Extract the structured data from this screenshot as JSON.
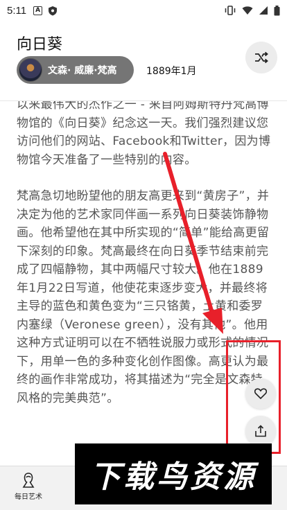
{
  "status_bar": {
    "time": "5:11",
    "left_icons": [
      "A-notification-icon",
      "shield-icon"
    ],
    "right_icons": [
      "vibrate-icon",
      "wifi-icon",
      "signal-icon",
      "battery-icon"
    ],
    "a_glyph": "A"
  },
  "header": {
    "title": "向日葵",
    "artist": "文森· 威廉·梵高",
    "date": "1889年1月"
  },
  "content": {
    "paragraphs": [
      "以来最伟大的杰作之一 - 来自阿姆斯特丹梵高博物馆的《向日葵》纪念这一天。我们强烈建议您访问他们的网站、Facebook和Twitter，因为博物馆今天准备了一些特别的内容。",
      "梵高急切地盼望他的朋友高更来到“黄房子”，并决定为他的艺术家同伴画一系列向日葵装饰静物画。他希望他在其中所实现的“简单”能给高更留下深刻的印象。梵高最终在向日葵季节结束前完成了四幅静物，其中两幅尺寸较大。他在1889年1月22日写道，他使花束逐步变大，并最终将主导的蓝色和黄色变为“三只铬黄，土黄和委罗内塞绿（Veronese green），没有其他”。他用这种方式证明可以在不牺牲说服力或形式的情况下，用单一色的多种变化创作图像。高更认为最终的画作非常成功，将其描述为“完全是文森特风格的完美典范”。"
    ]
  },
  "actions": {
    "shuffle": "shuffle-icon",
    "like": "heart-icon",
    "share": "share-icon"
  },
  "bottom_nav": {
    "items": [
      {
        "label": "每日艺术",
        "icon": "art-bust-icon"
      }
    ]
  },
  "watermark": {
    "text": "下载鸟资源"
  },
  "colors": {
    "annotation_red": "#e8202a",
    "chip_gray": "#757575",
    "fab_gray": "#ececec"
  }
}
